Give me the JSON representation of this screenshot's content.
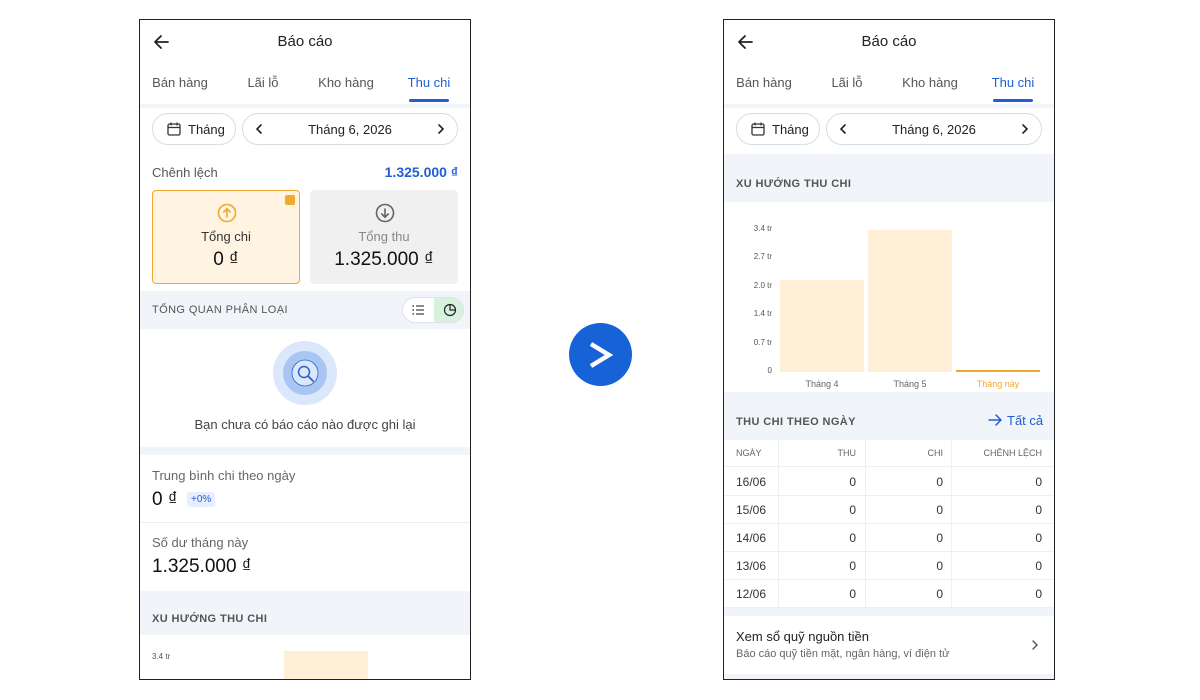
{
  "left": {
    "header": {
      "title": "Báo cáo"
    },
    "tabs": [
      {
        "label": "Bán hàng"
      },
      {
        "label": "Lãi lỗ"
      },
      {
        "label": "Kho hàng"
      },
      {
        "label": "Thu chi"
      }
    ],
    "period": {
      "mode": "Tháng",
      "label": "Tháng 6, 2026"
    },
    "difference": {
      "label": "Chênh lệch",
      "value": "1.325.000 ₫"
    },
    "cards": {
      "chi": {
        "label": "Tổng chi",
        "value": "0 ₫",
        "selected": true
      },
      "thu": {
        "label": "Tổng thu",
        "value": "1.325.000 ₫",
        "selected": false
      }
    },
    "overview": {
      "title": "TỔNG QUAN PHÂN LOẠI",
      "empty_text": "Bạn chưa có báo cáo nào được ghi lại"
    },
    "avg_daily": {
      "label": "Trung bình chi theo ngày",
      "value": "0 ₫",
      "badge": "+0%"
    },
    "balance": {
      "label": "Số dư tháng này",
      "value": "1.325.000 ₫"
    },
    "trend": {
      "title": "XU HƯỚNG THU CHI",
      "top_tick": "3.4 tr"
    }
  },
  "right": {
    "header": {
      "title": "Báo cáo"
    },
    "tabs": [
      {
        "label": "Bán hàng"
      },
      {
        "label": "Lãi lỗ"
      },
      {
        "label": "Kho hàng"
      },
      {
        "label": "Thu chi"
      }
    ],
    "period": {
      "mode": "Tháng",
      "label": "Tháng 6, 2026"
    },
    "trend": {
      "title": "XU HƯỚNG THU CHI"
    },
    "daily": {
      "title": "THU CHI THEO NGÀY",
      "link": "Tất cả",
      "columns": [
        "NGÀY",
        "THU",
        "CHI",
        "CHÊNH LỆCH"
      ],
      "rows": [
        [
          "16/06",
          "0",
          "0",
          "0"
        ],
        [
          "15/06",
          "0",
          "0",
          "0"
        ],
        [
          "14/06",
          "0",
          "0",
          "0"
        ],
        [
          "13/06",
          "0",
          "0",
          "0"
        ],
        [
          "12/06",
          "0",
          "0",
          "0"
        ]
      ]
    },
    "fund": {
      "title": "Xem sổ quỹ nguồn tiền",
      "subtitle": "Báo cáo quỹ tiền mặt, ngân hàng, ví điện tử"
    }
  },
  "chart_data": {
    "type": "bar",
    "categories": [
      "Tháng 4",
      "Tháng 5",
      "Tháng này"
    ],
    "values": [
      2.2,
      3.4,
      0.05
    ],
    "ylabel": "",
    "y_ticks": [
      "3.4 tr",
      "2.7 tr",
      "2.0 tr",
      "1.4 tr",
      "0.7 tr",
      "0"
    ],
    "ylim": [
      0,
      3.4
    ],
    "highlight_category": "Tháng này",
    "colors": {
      "bar": "#ffefd6",
      "current": "#f0a830"
    },
    "grid": false
  },
  "colors": {
    "accent": "#1f5fd6",
    "warning": "#f0a830",
    "success_bg": "#d7f2dc"
  }
}
